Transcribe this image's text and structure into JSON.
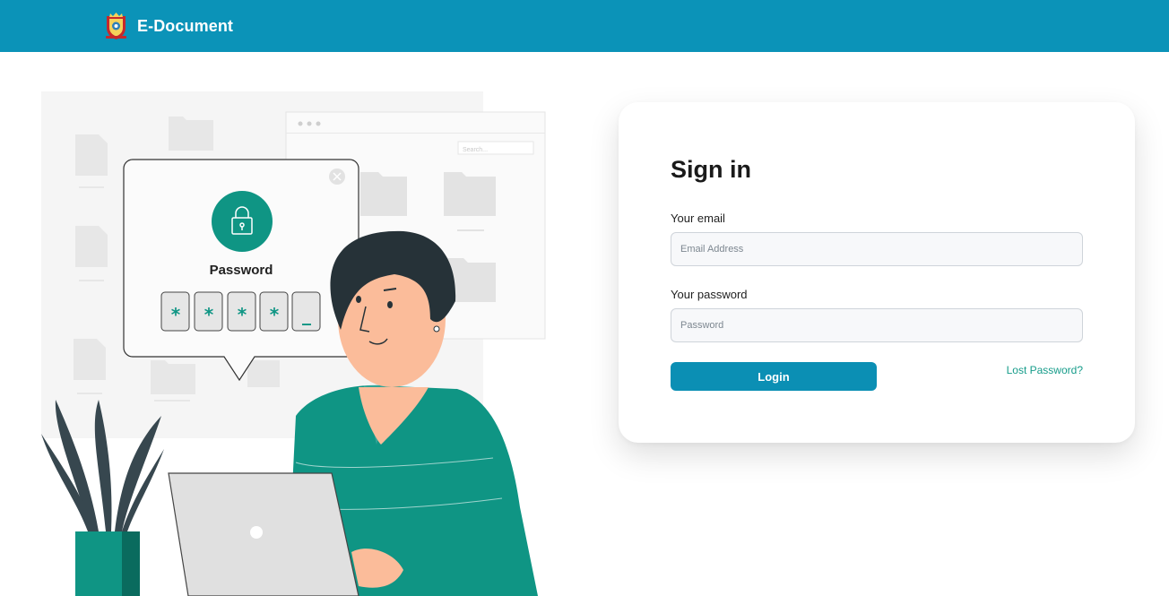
{
  "header": {
    "brand_name": "E-Document",
    "logo_icon": "crest-emblem-icon",
    "background_color": "#0b93b8"
  },
  "illustration": {
    "popup_title": "Password",
    "password_boxes": [
      "*",
      "*",
      "*",
      "*",
      "_"
    ],
    "window_search_placeholder": "Search...",
    "accent_color": "#0f9584"
  },
  "login": {
    "title": "Sign in",
    "email_label": "Your email",
    "email_placeholder": "Email Address",
    "email_value": "",
    "password_label": "Your password",
    "password_placeholder": "Password",
    "password_value": "",
    "login_button": "Login",
    "lost_password_link": "Lost Password?",
    "button_color": "#0b8fb4",
    "link_color": "#169c8a"
  }
}
